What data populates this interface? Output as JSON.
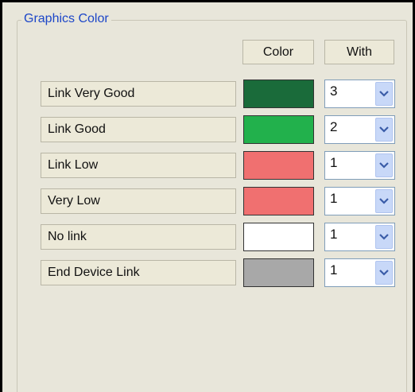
{
  "groupbox": {
    "title": "Graphics Color"
  },
  "columns": {
    "color_header": "Color",
    "width_header": "With"
  },
  "rows": [
    {
      "label": "Link Very Good",
      "color": "#1a6b3a",
      "width_value": "3"
    },
    {
      "label": "Link Good",
      "color": "#22b14c",
      "width_value": "2"
    },
    {
      "label": "Link Low",
      "color": "#f07070",
      "width_value": "1"
    },
    {
      "label": "Very Low",
      "color": "#f07070",
      "width_value": "1"
    },
    {
      "label": "No link",
      "color": "#ffffff",
      "width_value": "1"
    },
    {
      "label": "End Device Link",
      "color": "#a8a8a8",
      "width_value": "1"
    }
  ],
  "icons": {
    "dropdown": "chevron-down-icon"
  },
  "theme": {
    "panel_bg": "#e8e6da",
    "title_color": "#1c46c8",
    "dropdown_button": "#c8d8f8",
    "chevron_color": "#3a5ca8"
  }
}
